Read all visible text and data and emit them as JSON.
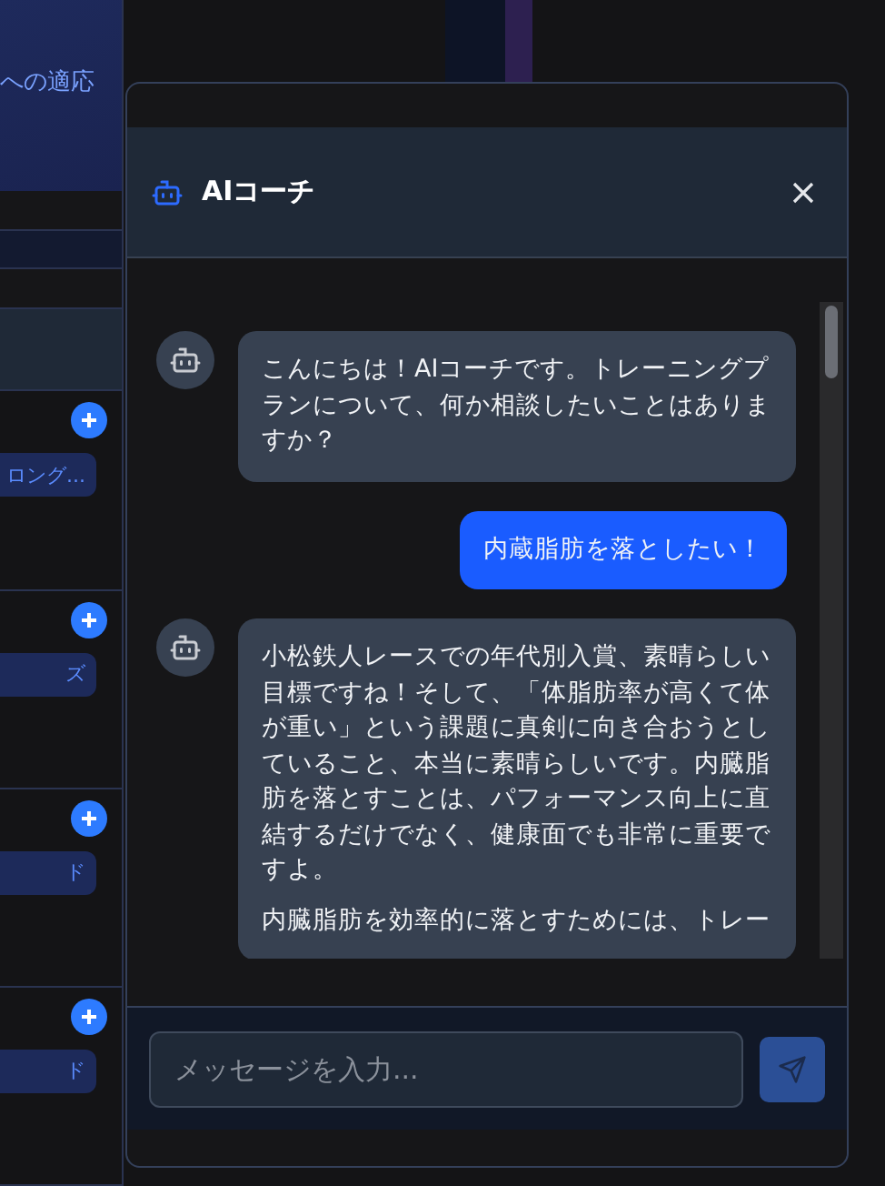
{
  "background": {
    "banner_text": "への適応",
    "sections": [
      {
        "tag": "ロング..."
      },
      {
        "tag": "ズ"
      },
      {
        "tag": "ド"
      },
      {
        "tag": "ド"
      }
    ]
  },
  "dialog": {
    "title": "AIコーチ",
    "messages": [
      {
        "kind": "bot",
        "paragraphs": [
          "こんにちは！AIコーチです。トレーニングプランについて、何か相談したいことはありますか？"
        ]
      },
      {
        "kind": "user",
        "paragraphs": [
          "内蔵脂肪を落としたい！"
        ]
      },
      {
        "kind": "bot",
        "paragraphs": [
          "小松鉄人レースでの年代別入賞、素晴らしい目標ですね！そして、「体脂肪率が高くて体が重い」という課題に真剣に向き合おうとしていること、本当に素晴らしいです。内臓脂肪を落とすことは、パフォーマンス向上に直結するだけでなく、健康面でも非常に重要ですよ。",
          "内臓脂肪を効率的に落とすためには、トレー"
        ]
      }
    ],
    "input": {
      "placeholder": "メッセージを入力..."
    }
  }
}
